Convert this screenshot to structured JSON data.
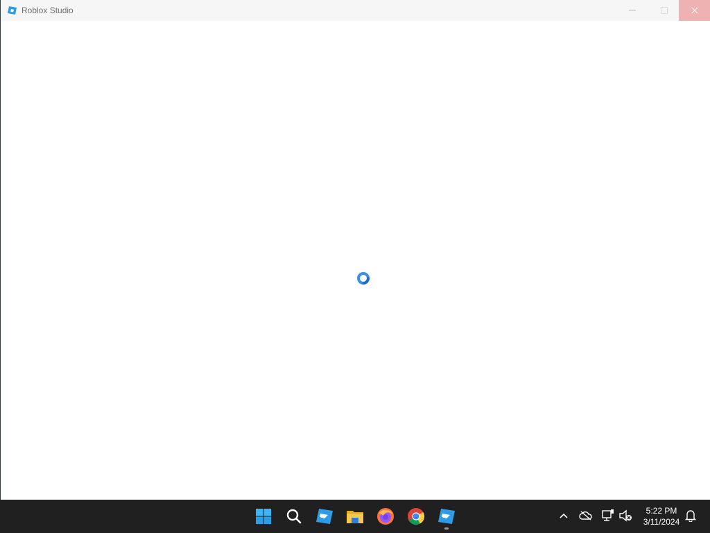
{
  "window": {
    "title": "Roblox Studio",
    "controls": {
      "minimize": "minimize-icon",
      "maximize": "maximize-icon",
      "close": "close-icon"
    },
    "content": {
      "loading_spinner": "spinner-icon",
      "accent": "#3a8fe6"
    }
  },
  "taskbar": {
    "pinned": [
      {
        "name": "start",
        "icon": "windows-start-icon"
      },
      {
        "name": "search",
        "icon": "search-icon"
      },
      {
        "name": "roblox-player",
        "icon": "roblox-icon"
      },
      {
        "name": "file-explorer",
        "icon": "folder-icon"
      },
      {
        "name": "firefox",
        "icon": "firefox-icon"
      },
      {
        "name": "chrome",
        "icon": "chrome-icon"
      },
      {
        "name": "roblox-studio",
        "icon": "roblox-studio-icon",
        "running": true
      }
    ],
    "tray": {
      "icons": [
        "chevron-up-icon",
        "onedrive-cloud-icon",
        "network-icon",
        "volume-muted-icon",
        "notification-bell-icon"
      ]
    },
    "clock": {
      "time": "5:22 PM",
      "date": "3/11/2024"
    }
  }
}
